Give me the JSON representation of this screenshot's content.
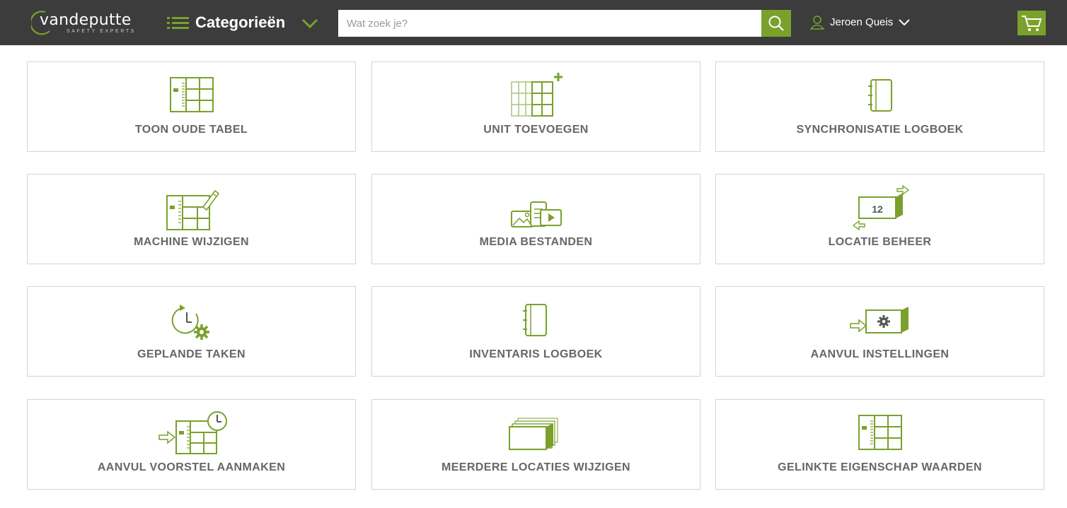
{
  "header": {
    "logo_text": "vandeputte",
    "logo_subtitle": "SAFETY EXPERTS",
    "categories_label": "Categorieën",
    "search_placeholder": "Wat zoek je?",
    "user_name": "Jeroen Queis",
    "accent_color": "#7aa12b",
    "bar_color": "#3c3c3c"
  },
  "tiles": [
    {
      "label": "TOON OUDE TABEL",
      "icon": "table-icon"
    },
    {
      "label": "UNIT TOEVOEGEN",
      "icon": "add-unit-icon"
    },
    {
      "label": "SYNCHRONISATIE LOGBOEK",
      "icon": "logbook-icon"
    },
    {
      "label": "MACHINE WIJZIGEN",
      "icon": "edit-machine-icon"
    },
    {
      "label": "MEDIA BESTANDEN",
      "icon": "media-icon"
    },
    {
      "label": "LOCATIE BEHEER",
      "icon": "location-icon"
    },
    {
      "label": "GEPLANDE TAKEN",
      "icon": "scheduled-tasks-icon"
    },
    {
      "label": "INVENTARIS LOGBOEK",
      "icon": "inventory-logbook-icon"
    },
    {
      "label": "AANVUL INSTELLINGEN",
      "icon": "refill-settings-icon"
    },
    {
      "label": "AANVUL VOORSTEL AANMAKEN",
      "icon": "refill-proposal-icon"
    },
    {
      "label": "MEERDERE LOCATIES WIJZIGEN",
      "icon": "multiple-locations-icon"
    },
    {
      "label": "GELINKTE EIGENSCHAP WAARDEN",
      "icon": "linked-property-icon"
    }
  ],
  "location_number": "12"
}
